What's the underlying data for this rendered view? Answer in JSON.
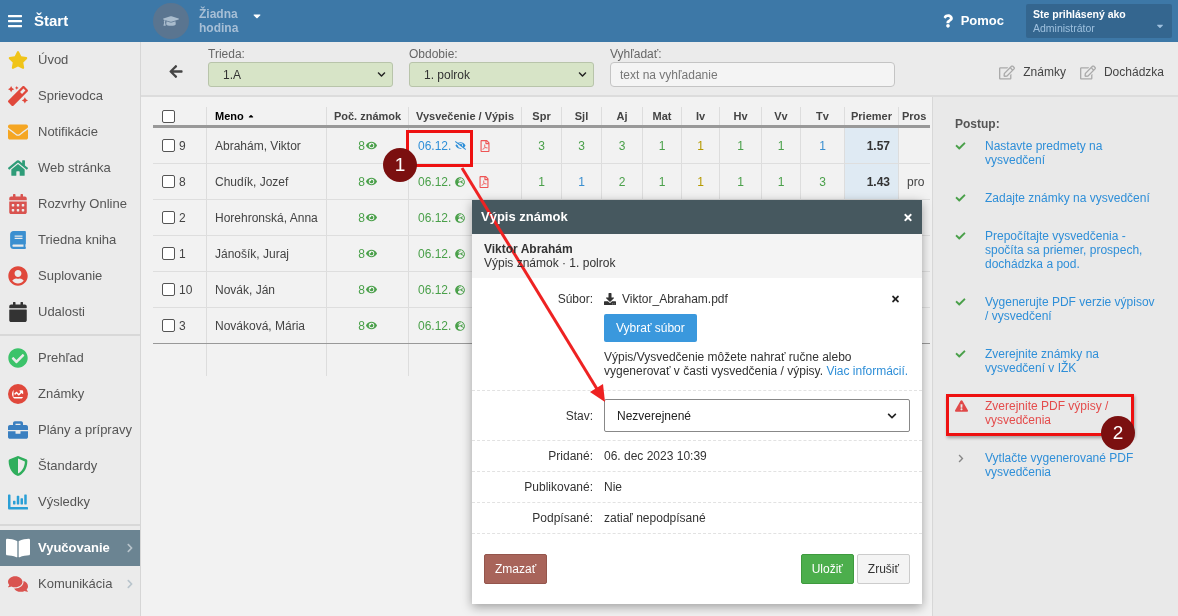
{
  "topbar": {
    "menu_label": "Štart",
    "lesson": "Žiadna hodina",
    "help": "Pomoc",
    "user": {
      "caption": "Ste prihlásený ako",
      "name": "Administrátor"
    }
  },
  "sidebar": {
    "groups": [
      {
        "items": [
          {
            "label": "Úvod",
            "selected": false,
            "expandable": false
          },
          {
            "label": "Sprievodca",
            "selected": false,
            "expandable": false
          },
          {
            "label": "Notifikácie",
            "selected": false,
            "expandable": false
          },
          {
            "label": "Web stránka",
            "selected": false,
            "expandable": false
          },
          {
            "label": "Rozvrhy Online",
            "selected": false,
            "expandable": false
          },
          {
            "label": "Triedna kniha",
            "selected": false,
            "expandable": false
          },
          {
            "label": "Suplovanie",
            "selected": false,
            "expandable": false
          },
          {
            "label": "Udalosti",
            "selected": false,
            "expandable": false
          }
        ]
      },
      {
        "items": [
          {
            "label": "Prehľad",
            "selected": false,
            "expandable": false
          },
          {
            "label": "Známky",
            "selected": false,
            "expandable": false
          },
          {
            "label": "Plány a prípravy",
            "selected": false,
            "expandable": false
          },
          {
            "label": "Štandardy",
            "selected": false,
            "expandable": false
          },
          {
            "label": "Výsledky",
            "selected": false,
            "expandable": false
          }
        ]
      },
      {
        "items": [
          {
            "label": "Vyučovanie",
            "selected": true,
            "expandable": true
          },
          {
            "label": "Komunikácia",
            "selected": false,
            "expandable": true
          }
        ]
      }
    ]
  },
  "toolbar": {
    "filters": [
      {
        "label": "Trieda:",
        "value": "1.A"
      },
      {
        "label": "Obdobie:",
        "value": "1. polrok"
      }
    ],
    "search": {
      "label": "Vyhľadať:",
      "placeholder": "text na vyhľadanie"
    },
    "actions": [
      "Známky",
      "Dochádzka"
    ]
  },
  "table": {
    "header_checked": false,
    "columns": [
      {
        "label": "Meno",
        "sorted": true
      },
      {
        "label": "Poč. známok",
        "sorted": false
      },
      {
        "label": "Vysvečenie / Výpis",
        "sorted": false
      },
      {
        "label": "Spr",
        "sorted": false
      },
      {
        "label": "Sjl",
        "sorted": false
      },
      {
        "label": "Aj",
        "sorted": false
      },
      {
        "label": "Mat",
        "sorted": false
      },
      {
        "label": "Iv",
        "sorted": false
      },
      {
        "label": "Hv",
        "sorted": false
      },
      {
        "label": "Vv",
        "sorted": false
      },
      {
        "label": "Tv",
        "sorted": false
      },
      {
        "label": "Priemer",
        "sorted": false
      },
      {
        "label": "Pros",
        "sorted": false
      }
    ],
    "rows": [
      {
        "checked": false,
        "number": "9",
        "name": "Abrahám, Viktor",
        "count": "8",
        "date": "06.12.",
        "published": false,
        "pdf": true,
        "grades": [
          {
            "value": "3",
            "color": "#4aa04a"
          },
          {
            "value": "3",
            "color": "#4aa04a"
          },
          {
            "value": "3",
            "color": "#4aa04a"
          },
          {
            "value": "1",
            "color": "#4aa04a"
          },
          {
            "value": "1",
            "color": "#b59a00"
          },
          {
            "value": "1",
            "color": "#4aa04a"
          },
          {
            "value": "1",
            "color": "#4aa04a"
          },
          {
            "value": "1",
            "color": "#3a8fd0"
          }
        ],
        "average": "1.57"
      },
      {
        "checked": false,
        "number": "8",
        "name": "Chudík, Jozef",
        "count": "8",
        "date": "06.12.",
        "published": true,
        "pdf": true,
        "grades": [
          {
            "value": "1",
            "color": "#4aa04a"
          },
          {
            "value": "1",
            "color": "#3a8fd0"
          },
          {
            "value": "2",
            "color": "#4aa04a"
          },
          {
            "value": "1",
            "color": "#4aa04a"
          },
          {
            "value": "1",
            "color": "#b59a00"
          },
          {
            "value": "1",
            "color": "#4aa04a"
          },
          {
            "value": "1",
            "color": "#4aa04a"
          },
          {
            "value": "3",
            "color": "#4aa04a"
          }
        ],
        "average": "1.43",
        "result": "pro"
      },
      {
        "checked": false,
        "number": "2",
        "name": "Horehronská, Anna",
        "count": "8",
        "date": "06.12.",
        "published": true,
        "pdf": false
      },
      {
        "checked": false,
        "number": "1",
        "name": "Jánošík, Juraj",
        "count": "8",
        "date": "06.12.",
        "published": true,
        "pdf": false
      },
      {
        "checked": false,
        "number": "10",
        "name": "Novák, Ján",
        "count": "8",
        "date": "06.12.",
        "published": true,
        "pdf": false
      },
      {
        "checked": false,
        "number": "3",
        "name": "Nováková, Mária",
        "count": "8",
        "date": "06.12.",
        "published": true,
        "pdf": false
      }
    ]
  },
  "modal": {
    "title": "Výpis známok",
    "student": "Viktor Abrahám",
    "subtitle": "Výpis známok · 1. polrok",
    "file": {
      "label": "Súbor:",
      "name": "Viktor_Abraham.pdf",
      "button": "Vybrať súbor",
      "help": "Výpis/Vysvedčenie môžete nahrať ručne alebo vygenerovať v časti vysvedčenia / výpisy.",
      "link": "Viac informácií."
    },
    "status": {
      "label": "Stav:",
      "value": "Nezverejnené"
    },
    "details": [
      {
        "label": "Pridané:",
        "value": "06. dec 2023 10:39"
      },
      {
        "label": "Publikované:",
        "value": "Nie"
      },
      {
        "label": "Podpísané:",
        "value": "zatiaľ nepodpísané"
      }
    ],
    "buttons": [
      {
        "label": "Zmazať",
        "kind": "danger"
      },
      {
        "label": "Uložiť",
        "kind": "primary"
      },
      {
        "label": "Zrušiť",
        "kind": "default"
      }
    ]
  },
  "steps_panel": {
    "title": "Postup:",
    "steps": [
      {
        "label": "Nastavte predmety na vysvedčení",
        "kind": "done"
      },
      {
        "label": "Zadajte známky na vysvedčení",
        "kind": "done"
      },
      {
        "label": "Prepočítajte vysvedčenia - spočíta sa priemer, prospech, dochádzka a pod.",
        "kind": "done"
      },
      {
        "label": "Vygenerujte PDF verzie výpisov / vysvedčení",
        "kind": "done"
      },
      {
        "label": "Zverejnite známky na vysvedčení v IŽK",
        "kind": "done"
      },
      {
        "label": "Zverejnite PDF výpisy / vysvedčenia",
        "kind": "warning"
      },
      {
        "label": "Vytlačte vygenerované PDF vysvedčenia",
        "kind": "pending"
      }
    ]
  },
  "callouts": [
    {
      "number": "1"
    },
    {
      "number": "2"
    }
  ]
}
